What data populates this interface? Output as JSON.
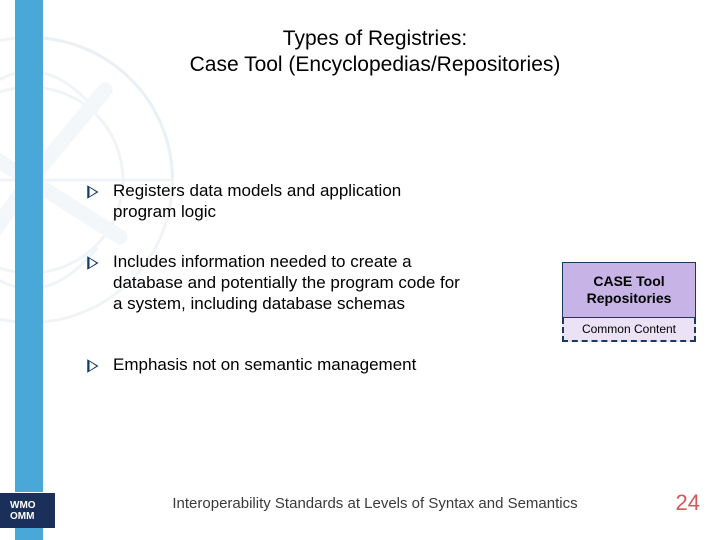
{
  "title": {
    "line1": "Types of Registries:",
    "line2": "Case Tool (Encyclopedias/Repositories)"
  },
  "bullets": [
    "Registers data models and application program logic",
    "Includes information needed to create a database and potentially the program code for a system, including database schemas",
    "Emphasis not on semantic management"
  ],
  "box": {
    "top": "CASE Tool Repositories",
    "bottom": "Common Content"
  },
  "footer": "Interoperability Standards at Levels of Syntax and Semantics",
  "page_number": "24",
  "badge": {
    "l1": "WMO",
    "l2": "OMM"
  },
  "colors": {
    "stripe": "#4aa8d8",
    "box_fill": "#c7b3e6",
    "box_sub": "#ebe3f5",
    "page_num": "#d05a5a"
  }
}
